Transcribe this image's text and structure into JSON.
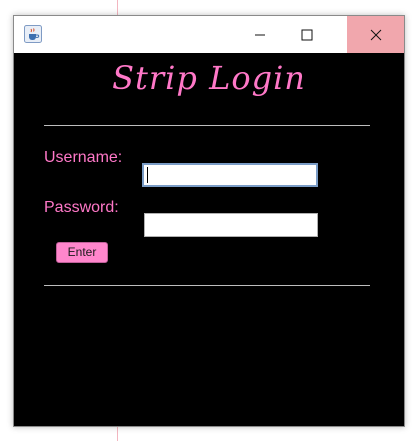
{
  "window": {
    "app_icon": "java-cup-icon",
    "controls": {
      "minimize_icon": "minimize-icon",
      "maximize_icon": "maximize-icon",
      "close_icon": "close-icon"
    }
  },
  "form": {
    "heading": "Strip Login",
    "username_label": "Username:",
    "username_value": "",
    "password_label": "Password:",
    "password_value": "",
    "enter_label": "Enter"
  },
  "colors": {
    "accent_pink": "#ff78c8",
    "button_pink": "#ff86cc",
    "background": "#000000",
    "close_hover": "#f1a7ad"
  }
}
